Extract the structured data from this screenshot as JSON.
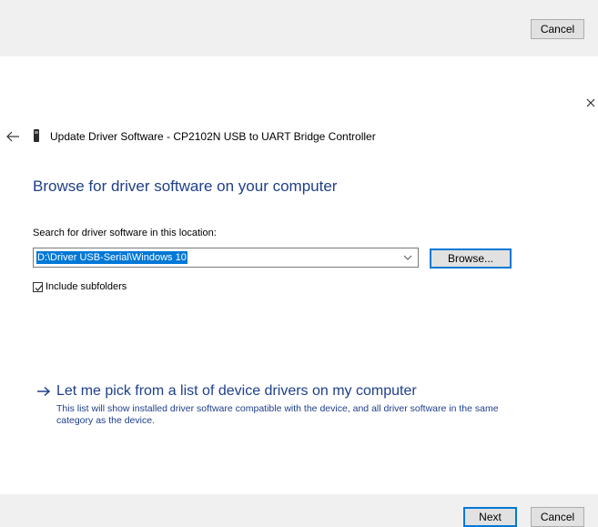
{
  "top_bar": {
    "cancel_label": "Cancel"
  },
  "dialog": {
    "close_icon": "close-icon",
    "back_icon": "back-arrow-icon",
    "device_icon": "usb-device-icon",
    "window_title": "Update Driver Software - CP2102N USB to UART Bridge Controller",
    "heading": "Browse for driver software on your computer",
    "search_label": "Search for driver software in this location:",
    "path_value": "D:\\Driver USB-Serial\\Windows 10",
    "browse_label": "Browse...",
    "include_subfolders": {
      "label": "Include subfolders",
      "checked": true
    },
    "pick_link": {
      "icon": "arrow-right-icon",
      "title": "Let me pick from a list of device drivers on my computer",
      "description": "This list will show installed driver software compatible with the device, and all driver software in the same category as the device."
    }
  },
  "footer": {
    "next_label": "Next",
    "cancel_label": "Cancel"
  },
  "colors": {
    "heading": "#1e3f8a",
    "selection": "#0078d7",
    "bar_background": "#f0f0f0",
    "button_face": "#e1e1e1"
  }
}
